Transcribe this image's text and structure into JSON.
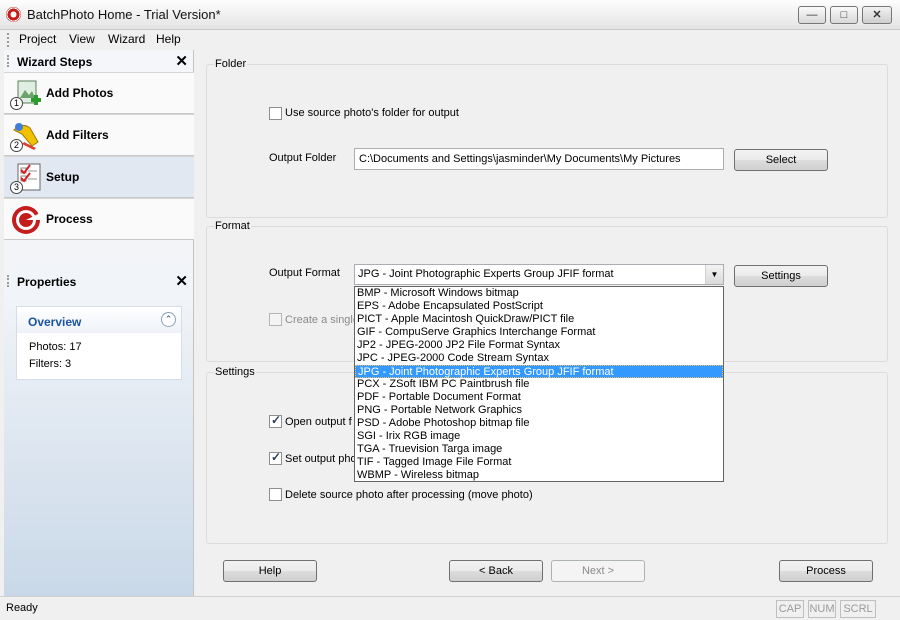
{
  "window": {
    "title": "BatchPhoto Home - Trial Version*",
    "minimize": "▭",
    "maximize": "□",
    "close": "✕"
  },
  "menu": [
    "Project",
    "View",
    "Wizard",
    "Help"
  ],
  "wizard": {
    "header": "Wizard Steps",
    "close": "✕",
    "steps": [
      {
        "label": "Add Photos",
        "num": "1"
      },
      {
        "label": "Add Filters",
        "num": "2"
      },
      {
        "label": "Setup",
        "num": "3"
      },
      {
        "label": "Process",
        "num": ""
      }
    ],
    "active_step": "Setup"
  },
  "properties": {
    "header": "Properties",
    "close": "✕",
    "overview_title": "Overview",
    "collapse": "⌃",
    "photos": "Photos: 17",
    "filters": "Filters: 3"
  },
  "folder": {
    "title": "Folder",
    "use_source_label": "Use source photo's folder for output",
    "use_source_checked": false,
    "output_folder_label": "Output Folder",
    "output_folder_value": "C:\\Documents and Settings\\jasminder\\My Documents\\My Pictures",
    "select_button": "Select"
  },
  "format": {
    "title": "Format",
    "output_format_label": "Output Format",
    "output_format_value": "JPG - Joint Photographic Experts Group JFIF format",
    "settings_button": "Settings",
    "create_single_label": "Create a single",
    "options": [
      "BMP - Microsoft Windows bitmap",
      "EPS - Adobe Encapsulated PostScript",
      "PICT - Apple Macintosh QuickDraw/PICT file",
      "GIF - CompuServe Graphics Interchange Format",
      "JP2 - JPEG-2000 JP2 File Format Syntax",
      "JPC - JPEG-2000 Code Stream Syntax",
      "JPG - Joint Photographic Experts Group JFIF format",
      "PCX - ZSoft IBM PC Paintbrush file",
      "PDF - Portable Document Format",
      "PNG - Portable Network Graphics",
      "PSD - Adobe Photoshop bitmap file",
      "SGI - Irix RGB image",
      "TGA - Truevision Targa image",
      "TIF - Tagged Image File Format",
      "WBMP - Wireless bitmap"
    ],
    "selected_option": "JPG - Joint Photographic Experts Group JFIF format"
  },
  "settings": {
    "title": "Settings",
    "open_output_label": "Open output f",
    "open_output_checked": true,
    "set_output_label": "Set output pho",
    "set_output_checked": true,
    "delete_source_label": "Delete source photo after processing (move photo)",
    "delete_source_checked": false
  },
  "buttons": {
    "help": "Help",
    "back": "< Back",
    "next": "Next >",
    "process": "Process"
  },
  "status": {
    "text": "Ready",
    "cap": "CAP",
    "num": "NUM",
    "scrl": "SCRL"
  },
  "colors": {
    "selection": "#3399ff",
    "overview_title": "#1a55a0",
    "active_step_bg": "#e2e8f1"
  }
}
